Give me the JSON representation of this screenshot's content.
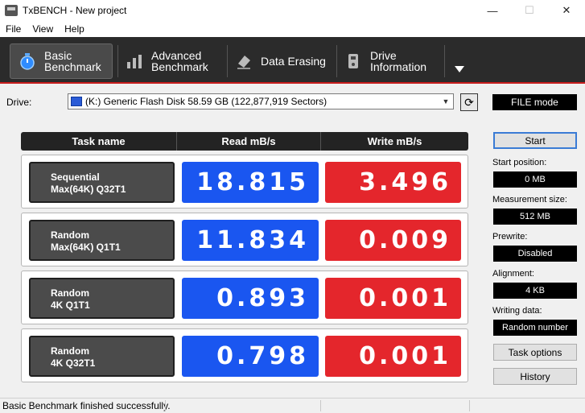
{
  "window": {
    "title": "TxBENCH - New project"
  },
  "menu": [
    "File",
    "View",
    "Help"
  ],
  "toolbar": {
    "tabs": [
      {
        "line1": "Basic",
        "line2": "Benchmark",
        "icon": "stopwatch-icon"
      },
      {
        "line1": "Advanced",
        "line2": "Benchmark",
        "icon": "bar-chart-icon"
      },
      {
        "line1": "Data Erasing",
        "line2": "",
        "icon": "eraser-icon"
      },
      {
        "line1": "Drive",
        "line2": "Information",
        "icon": "drive-info-icon"
      }
    ]
  },
  "drive": {
    "label": "Drive:",
    "selected": "(K:) Generic Flash Disk  58.59 GB (122,877,919 Sectors)",
    "mode": "FILE mode"
  },
  "table": {
    "headers": [
      "Task name",
      "Read mB/s",
      "Write mB/s"
    ],
    "rows": [
      {
        "line1": "Sequential",
        "line2": "Max(64K) Q32T1",
        "read": "18.815",
        "write": "3.496"
      },
      {
        "line1": "Random",
        "line2": "Max(64K) Q1T1",
        "read": "11.834",
        "write": "0.009"
      },
      {
        "line1": "Random",
        "line2": "4K Q1T1",
        "read": "0.893",
        "write": "0.001"
      },
      {
        "line1": "Random",
        "line2": "4K Q32T1",
        "read": "0.798",
        "write": "0.001"
      }
    ]
  },
  "side": {
    "start": "Start",
    "start_position_label": "Start position:",
    "start_position": "0 MB",
    "measurement_size_label": "Measurement size:",
    "measurement_size": "512 MB",
    "prewrite_label": "Prewrite:",
    "prewrite": "Disabled",
    "alignment_label": "Alignment:",
    "alignment": "4 KB",
    "writing_data_label": "Writing data:",
    "writing_data": "Random number",
    "task_options": "Task options",
    "history": "History"
  },
  "status": {
    "message": "Basic Benchmark finished successfully."
  }
}
